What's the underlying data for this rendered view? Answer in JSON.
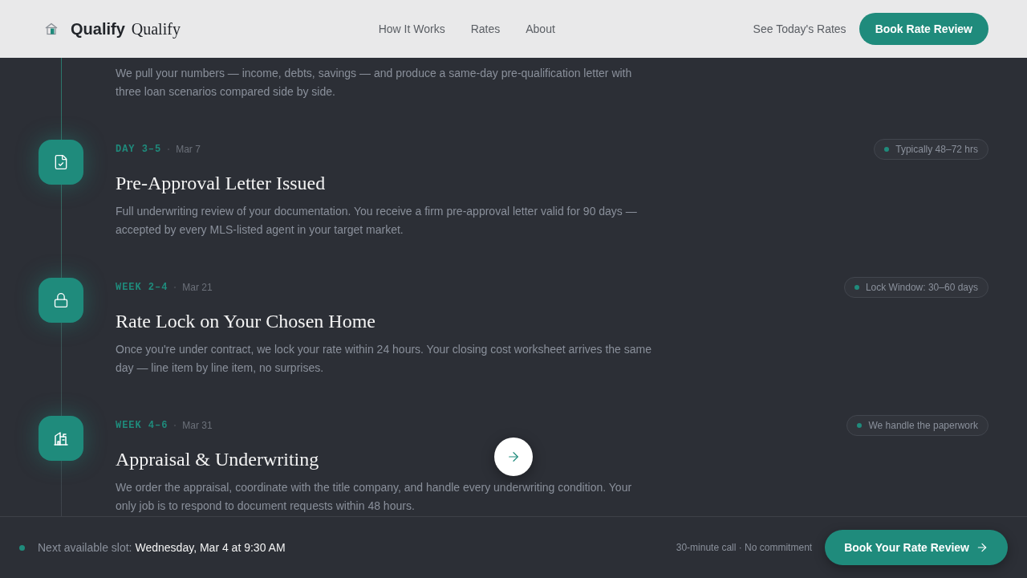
{
  "header": {
    "brand": {
      "name": "Qualify",
      "wordmark": "Qualify"
    },
    "nav": [
      {
        "label": "How It Works"
      },
      {
        "label": "Rates"
      },
      {
        "label": "About"
      }
    ],
    "secondary_link": "See Today's Rates",
    "cta": "Book Rate Review"
  },
  "timeline": {
    "steps": [
      {
        "kind": "continued",
        "description": "We pull your numbers — income, debts, savings — and produce a same-day pre-qualification letter with three loan scenarios compared side by side."
      },
      {
        "kind": "step",
        "phase": "DAY 3–5",
        "date": "Mar 7",
        "title": "Pre-Approval Letter Issued",
        "description": "Full underwriting review of your documentation. You receive a firm pre-approval letter valid for 90 days — accepted by every MLS-listed agent in your target market.",
        "badge": "Typically 48–72 hrs"
      },
      {
        "kind": "step",
        "phase": "WEEK 2–4",
        "date": "Mar 21",
        "title": "Rate Lock on Your Chosen Home",
        "description": "Once you're under contract, we lock your rate within 24 hours. Your closing cost worksheet arrives the same day — line item by line item, no surprises.",
        "badge": "Lock Window: 30–60 days"
      },
      {
        "kind": "step",
        "phase": "WEEK 4–6",
        "date": "Mar 31",
        "title": "Appraisal & Underwriting",
        "description": "We order the appraisal, coordinate with the title company, and handle every underwriting condition. Your only job is to respond to document requests within 48 hours.",
        "badge": "We handle the paperwork"
      }
    ]
  },
  "booking_bar": {
    "label": "Next available slot:",
    "slot": "Wednesday, Mar 4 at 9:30 AM",
    "note": "30-minute call · No commitment",
    "cta": "Book Your Rate Review"
  }
}
